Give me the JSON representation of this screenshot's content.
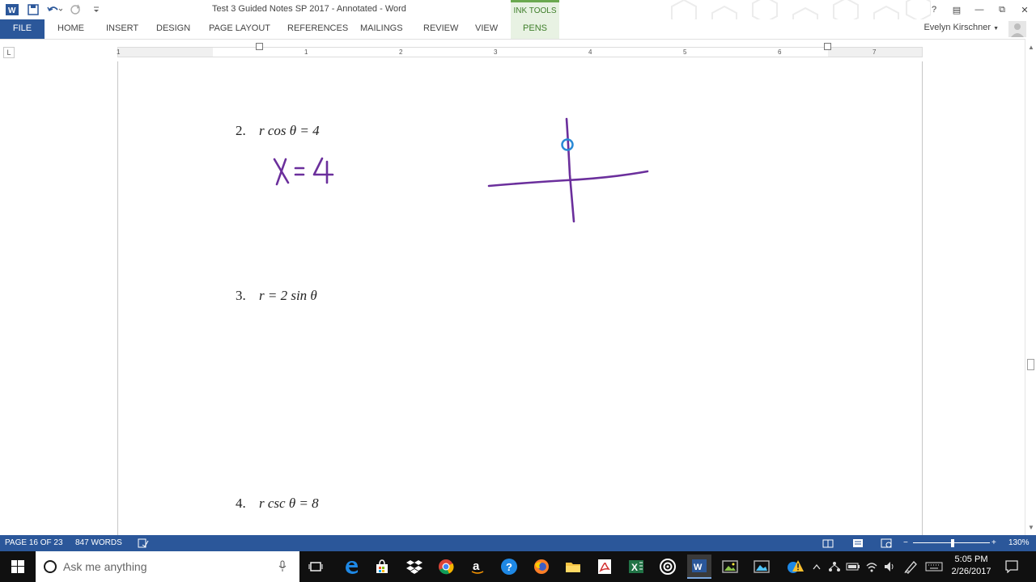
{
  "window": {
    "title": "Test 3 Guided Notes SP 2017 - Annotated - Word",
    "contextual_tab_group": "INK TOOLS",
    "user": "Evelyn Kirschner",
    "controls": {
      "help": "?",
      "ribbon_options": "▤",
      "minimize": "—",
      "restore": "⧉",
      "close": "✕"
    },
    "brand_color": "#2b579a",
    "ink_tools_color": "#6aa84f"
  },
  "ribbon": {
    "tabs": [
      "FILE",
      "HOME",
      "INSERT",
      "DESIGN",
      "PAGE LAYOUT",
      "REFERENCES",
      "MAILINGS",
      "REVIEW",
      "VIEW",
      "PENS"
    ]
  },
  "ruler": {
    "corner": "L",
    "numbers": [
      "1",
      "1",
      "2",
      "3",
      "4",
      "5",
      "6",
      "7"
    ]
  },
  "document": {
    "problems": [
      {
        "number": "2.",
        "equation": "r cos θ = 4"
      },
      {
        "number": "3.",
        "equation": "r = 2 sin θ"
      },
      {
        "number": "4.",
        "equation": "r csc θ = 8"
      }
    ],
    "ink_color": "#6b2f9c",
    "handwriting": "X=4"
  },
  "statusbar": {
    "page": "PAGE 16 OF 23",
    "words": "847 WORDS",
    "zoom": "130%",
    "zoom_minus": "−",
    "zoom_plus": "+"
  },
  "taskbar": {
    "search_placeholder": "Ask me anything",
    "time": "5:05 PM",
    "date": "2/26/2017",
    "apps": [
      "task-view",
      "edge",
      "store",
      "dropbox",
      "chrome",
      "amazon",
      "help",
      "firefox",
      "file-explorer",
      "acrobat",
      "excel",
      "target",
      "word",
      "photos",
      "media"
    ]
  }
}
